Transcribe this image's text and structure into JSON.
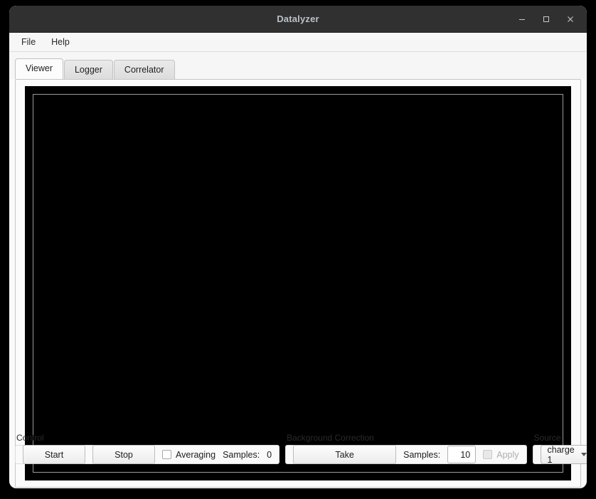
{
  "window": {
    "title": "Datalyzer",
    "controls": [
      {
        "name": "minimize-button",
        "glyph": "minimize-icon"
      },
      {
        "name": "maximize-button",
        "glyph": "maximize-icon"
      },
      {
        "name": "close-button",
        "glyph": "close-icon"
      }
    ]
  },
  "menubar": {
    "items": [
      {
        "label": "File"
      },
      {
        "label": "Help"
      }
    ]
  },
  "tabs": [
    {
      "label": "Viewer",
      "active": true
    },
    {
      "label": "Logger",
      "active": false
    },
    {
      "label": "Correlator",
      "active": false
    }
  ],
  "plot": {
    "background_color": "#000000",
    "border_color": "#9a9a9a",
    "content": ""
  },
  "control_group": {
    "title": "Control",
    "start_label": "Start",
    "stop_label": "Stop",
    "averaging_label": "Averaging",
    "averaging_checked": false,
    "samples_label": "Samples:",
    "samples_value": "0"
  },
  "background_group": {
    "title": "Background Correction",
    "take_label": "Take",
    "samples_label": "Samples:",
    "samples_value": "10",
    "apply_label": "Apply",
    "apply_checked": false,
    "apply_enabled": false
  },
  "source_group": {
    "title": "Source",
    "selected": "charge 1"
  },
  "colors": {
    "titlebar": "#303030",
    "title_text": "#b9c2c9",
    "window_bg": "#fafafa",
    "plot_bg": "#000000",
    "disabled_text": "#aeaeae"
  }
}
